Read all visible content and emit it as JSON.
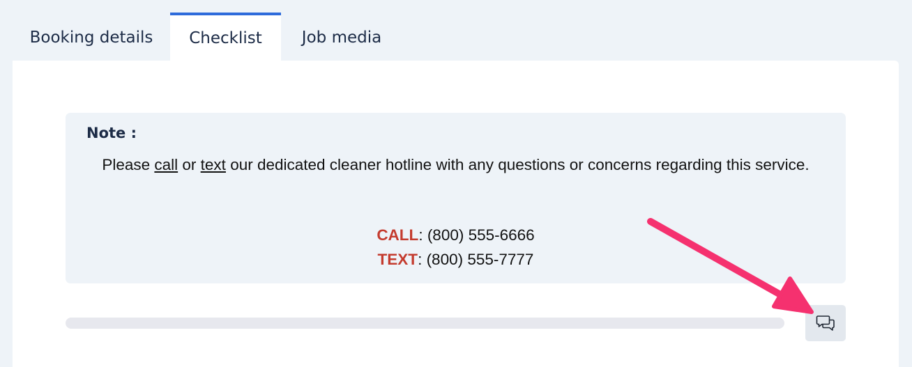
{
  "tabs": [
    {
      "label": "Booking details",
      "active": false
    },
    {
      "label": "Checklist",
      "active": true
    },
    {
      "label": "Job media",
      "active": false
    }
  ],
  "note": {
    "title": "Note :",
    "prefix": "Please ",
    "call_link": "call",
    "middle": " or ",
    "text_link": "text",
    "suffix": " our dedicated cleaner hotline with any questions or concerns regarding this service.",
    "call_label": "CALL",
    "call_value": ": (800) 555-6666",
    "text_label": "TEXT",
    "text_value": ": (800) 555-7777"
  },
  "progress": {
    "fraction": 0
  },
  "comment_button": {
    "icon": "chat-bubbles-icon"
  },
  "colors": {
    "accent": "#2e6bdb",
    "contact_label": "#c43b2e",
    "annotation_arrow": "#f5316f",
    "note_background": "#eef3f8"
  }
}
